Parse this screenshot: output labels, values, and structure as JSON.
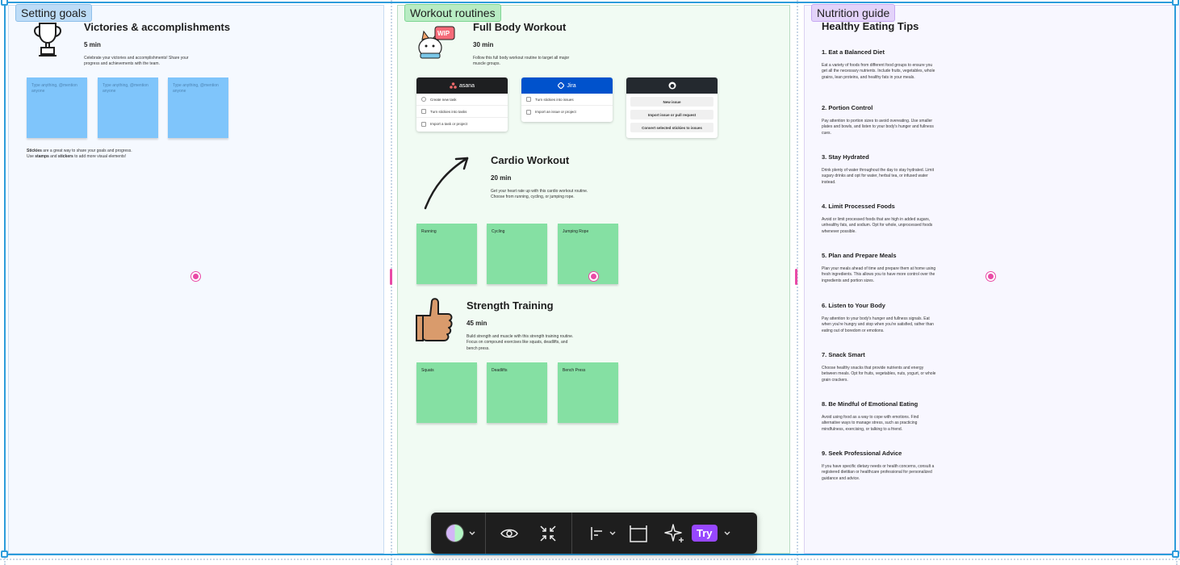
{
  "sections": {
    "goals": {
      "label": "Setting goals",
      "title": "Victories & accomplishments",
      "duration": "5 min",
      "description": "Celebrate your victories and accomplishments! Share your progress and achievements with the team.",
      "stickies": [
        "Type anything, @mention anyone",
        "Type anything, @mention anyone",
        "Type anything, @mention anyone"
      ],
      "tip_strong1": "Stickies",
      "tip_rest1": " are a great way to share your goals and progress.",
      "tip_prefix2": "Use ",
      "tip_strong2": "stamps",
      "tip_mid2": " and ",
      "tip_strong3": "stickers",
      "tip_rest2": " to add more visual elements!"
    },
    "workout": {
      "label": "Workout routines",
      "full_body": {
        "title": "Full Body Workout",
        "duration": "30 min",
        "description": "Follow this full body workout routine to target all major muscle groups.",
        "wip_badge": "WIP"
      },
      "asana": {
        "brand": "asana",
        "rows": [
          "Create new task",
          "Turn stickies into tasks",
          "Import a task or project"
        ]
      },
      "jira": {
        "brand": "Jira",
        "rows": [
          "Turn stickies into issues",
          "Import an issue or project"
        ]
      },
      "github": {
        "buttons": [
          "New issue",
          "Import issue or pull request",
          "Convert selected stickies to issues"
        ]
      },
      "cardio": {
        "title": "Cardio Workout",
        "duration": "20 min",
        "description": "Get your heart rate up with this cardio workout routine. Choose from running, cycling, or jumping rope.",
        "stickies": [
          "Running",
          "Cycling",
          "Jumping Rope"
        ]
      },
      "strength": {
        "title": "Strength Training",
        "duration": "45 min",
        "description": "Build strength and muscle with this strength training routine. Focus on compound exercises like squats, deadlifts, and bench press.",
        "stickies": [
          "Squats",
          "Deadlifts",
          "Bench Press"
        ]
      }
    },
    "nutrition": {
      "label": "Nutrition guide",
      "title": "Healthy Eating Tips",
      "tips": [
        {
          "heading": "1. Eat a Balanced Diet",
          "text": "Eat a variety of foods from different food groups to ensure you get all the necessary nutrients. Include fruits, vegetables, whole grains, lean proteins, and healthy fats in your meals."
        },
        {
          "heading": "2. Portion Control",
          "text": "Pay attention to portion sizes to avoid overeating. Use smaller plates and bowls, and listen to your body's hunger and fullness cues."
        },
        {
          "heading": "3. Stay Hydrated",
          "text": "Drink plenty of water throughout the day to stay hydrated. Limit sugary drinks and opt for water, herbal tea, or infused water instead."
        },
        {
          "heading": "4. Limit Processed Foods",
          "text": "Avoid or limit processed foods that are high in added sugars, unhealthy fats, and sodium. Opt for whole, unprocessed foods whenever possible."
        },
        {
          "heading": "5. Plan and Prepare Meals",
          "text": "Plan your meals ahead of time and prepare them at home using fresh ingredients. This allows you to have more control over the ingredients and portion sizes."
        },
        {
          "heading": "6. Listen to Your Body",
          "text": "Pay attention to your body's hunger and fullness signals. Eat when you're hungry and stop when you're satisfied, rather than eating out of boredom or emotions."
        },
        {
          "heading": "7. Snack Smart",
          "text": "Choose healthy snacks that provide nutrients and energy between meals. Opt for fruits, vegetables, nuts, yogurt, or whole grain crackers."
        },
        {
          "heading": "8. Be Mindful of Emotional Eating",
          "text": "Avoid using food as a way to cope with emotions. Find alternative ways to manage stress, such as practicing mindfulness, exercising, or talking to a friend."
        },
        {
          "heading": "9. Seek Professional Advice",
          "text": "If you have specific dietary needs or health concerns, consult a registered dietitian or healthcare professional for personalized guidance and advice."
        }
      ]
    }
  },
  "toolbar": {
    "try_label": "Try",
    "icons": [
      "color-picker-icon",
      "chevron-down-icon",
      "eye-icon",
      "collapse-icon",
      "align-left-icon",
      "chevron-down-icon",
      "frame-icon",
      "sparkle-icon",
      "chevron-down-icon"
    ]
  },
  "colors": {
    "selection": "#2d9cdb",
    "sticky_blue": "#7fc5fb",
    "sticky_green": "#85e0a3",
    "accent_pink": "#e94aa6",
    "try_purple": "#9747ff",
    "asana_header": "#1e1f21",
    "jira_header": "#0052cc",
    "github_header": "#24292f"
  }
}
